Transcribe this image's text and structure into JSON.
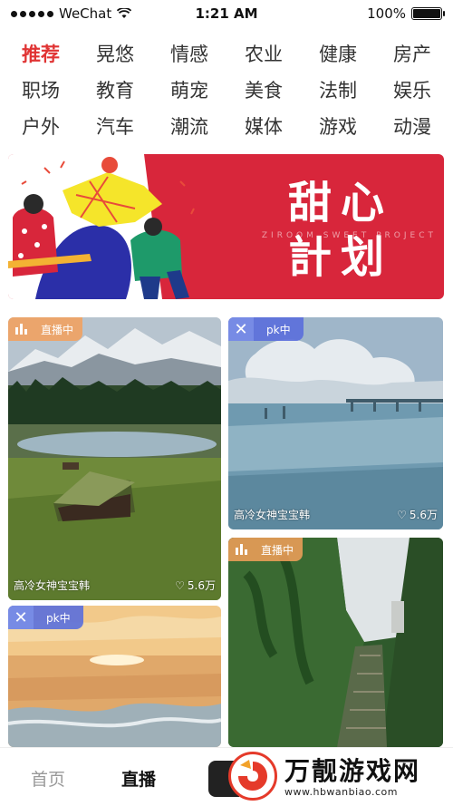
{
  "status_bar": {
    "carrier": "WeChat",
    "time": "1:21 AM",
    "battery": "100%",
    "battery_level": 1.0
  },
  "categories": [
    {
      "label": "推荐",
      "active": true
    },
    {
      "label": "晃悠"
    },
    {
      "label": "情感"
    },
    {
      "label": "农业"
    },
    {
      "label": "健康"
    },
    {
      "label": "房产"
    },
    {
      "label": "职场"
    },
    {
      "label": "教育"
    },
    {
      "label": "萌宠"
    },
    {
      "label": "美食"
    },
    {
      "label": "法制"
    },
    {
      "label": "娱乐"
    },
    {
      "label": "户外"
    },
    {
      "label": "汽车"
    },
    {
      "label": "潮流"
    },
    {
      "label": "媒体"
    },
    {
      "label": "游戏"
    },
    {
      "label": "动漫"
    }
  ],
  "banner": {
    "title_line1": "甜心",
    "title_line2": "計划",
    "subtitle": "ZIROOM SWEET PROJECT"
  },
  "cards": [
    {
      "tag": "直播中",
      "tag_type": "live",
      "name": "高冷女神宝宝韩",
      "likes": "5.6万",
      "scene": "mountain-lake-cabin"
    },
    {
      "tag": "pk中",
      "tag_type": "pk",
      "name": "高冷女神宝宝韩",
      "likes": "5.6万",
      "scene": "lake-clouds"
    },
    {
      "tag": "直播中",
      "tag_type": "live",
      "name": "",
      "likes": "",
      "scene": "cliff-stairs"
    },
    {
      "tag": "pk中",
      "tag_type": "pk",
      "name": "",
      "likes": "",
      "scene": "sunset-sea"
    }
  ],
  "bottom_nav": {
    "tabs": [
      {
        "label": "首页"
      },
      {
        "label": "直播",
        "active": true
      }
    ]
  },
  "watermark": {
    "title": "万靓游戏网",
    "url": "www.hbwanbiao.com"
  },
  "colors": {
    "accent": "#e03434",
    "banner_bg": "#d8263b",
    "live_tag": "#f5a05a",
    "pk_tag": "#5a6edc"
  },
  "icons": {
    "signal": "signal-dots-icon",
    "wifi": "wifi-icon",
    "battery": "battery-icon",
    "live": "bar-chart-icon",
    "pk": "close-x-icon",
    "likes": "heart-icon"
  }
}
